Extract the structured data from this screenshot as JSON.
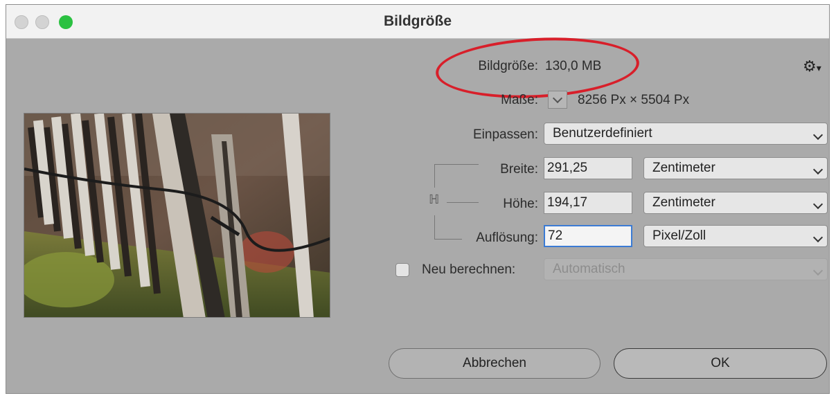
{
  "window": {
    "title": "Bildgröße"
  },
  "info": {
    "size_label": "Bildgröße:",
    "size_value": "130,0 MB",
    "dims_label": "Maße:",
    "dims_value": "8256 Px  ×  5504 Px"
  },
  "fit": {
    "label": "Einpassen:",
    "value": "Benutzerdefiniert"
  },
  "width": {
    "label": "Breite:",
    "value": "291,25",
    "unit": "Zentimeter"
  },
  "height": {
    "label": "Höhe:",
    "value": "194,17",
    "unit": "Zentimeter"
  },
  "resolution": {
    "label": "Auflösung:",
    "value": "72",
    "unit": "Pixel/Zoll"
  },
  "resample": {
    "label": "Neu berechnen:",
    "checked": false,
    "value": "Automatisch"
  },
  "buttons": {
    "cancel": "Abbrechen",
    "ok": "OK"
  },
  "icons": {
    "settings": "gear-icon",
    "link": "chain-link-icon",
    "dims_dropdown": "chevron-down-icon"
  },
  "colors": {
    "annotation": "#d81f2a",
    "focus": "#3b7bd4",
    "maximize": "#2bc141"
  }
}
